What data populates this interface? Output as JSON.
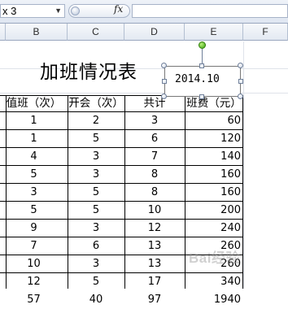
{
  "toolbar": {
    "namebox_value": "x 3",
    "fx_label": "fx",
    "formula_value": ""
  },
  "columns": [
    "B",
    "C",
    "D",
    "E",
    "F"
  ],
  "title": "加班情况表",
  "textbox": {
    "text": "2014.10"
  },
  "table": {
    "headers": [
      "值班（次）",
      "开会（次）",
      "共计",
      "班费（元）"
    ],
    "rows": [
      [
        "1",
        "2",
        "3",
        "60"
      ],
      [
        "1",
        "5",
        "6",
        "120"
      ],
      [
        "4",
        "3",
        "7",
        "140"
      ],
      [
        "5",
        "3",
        "8",
        "160"
      ],
      [
        "3",
        "5",
        "8",
        "160"
      ],
      [
        "5",
        "5",
        "10",
        "200"
      ],
      [
        "9",
        "3",
        "12",
        "240"
      ],
      [
        "7",
        "6",
        "13",
        "260"
      ],
      [
        "10",
        "3",
        "13",
        "260"
      ],
      [
        "12",
        "5",
        "17",
        "340"
      ],
      [
        "57",
        "40",
        "97",
        "1940"
      ]
    ]
  },
  "watermark": "Bai经验"
}
